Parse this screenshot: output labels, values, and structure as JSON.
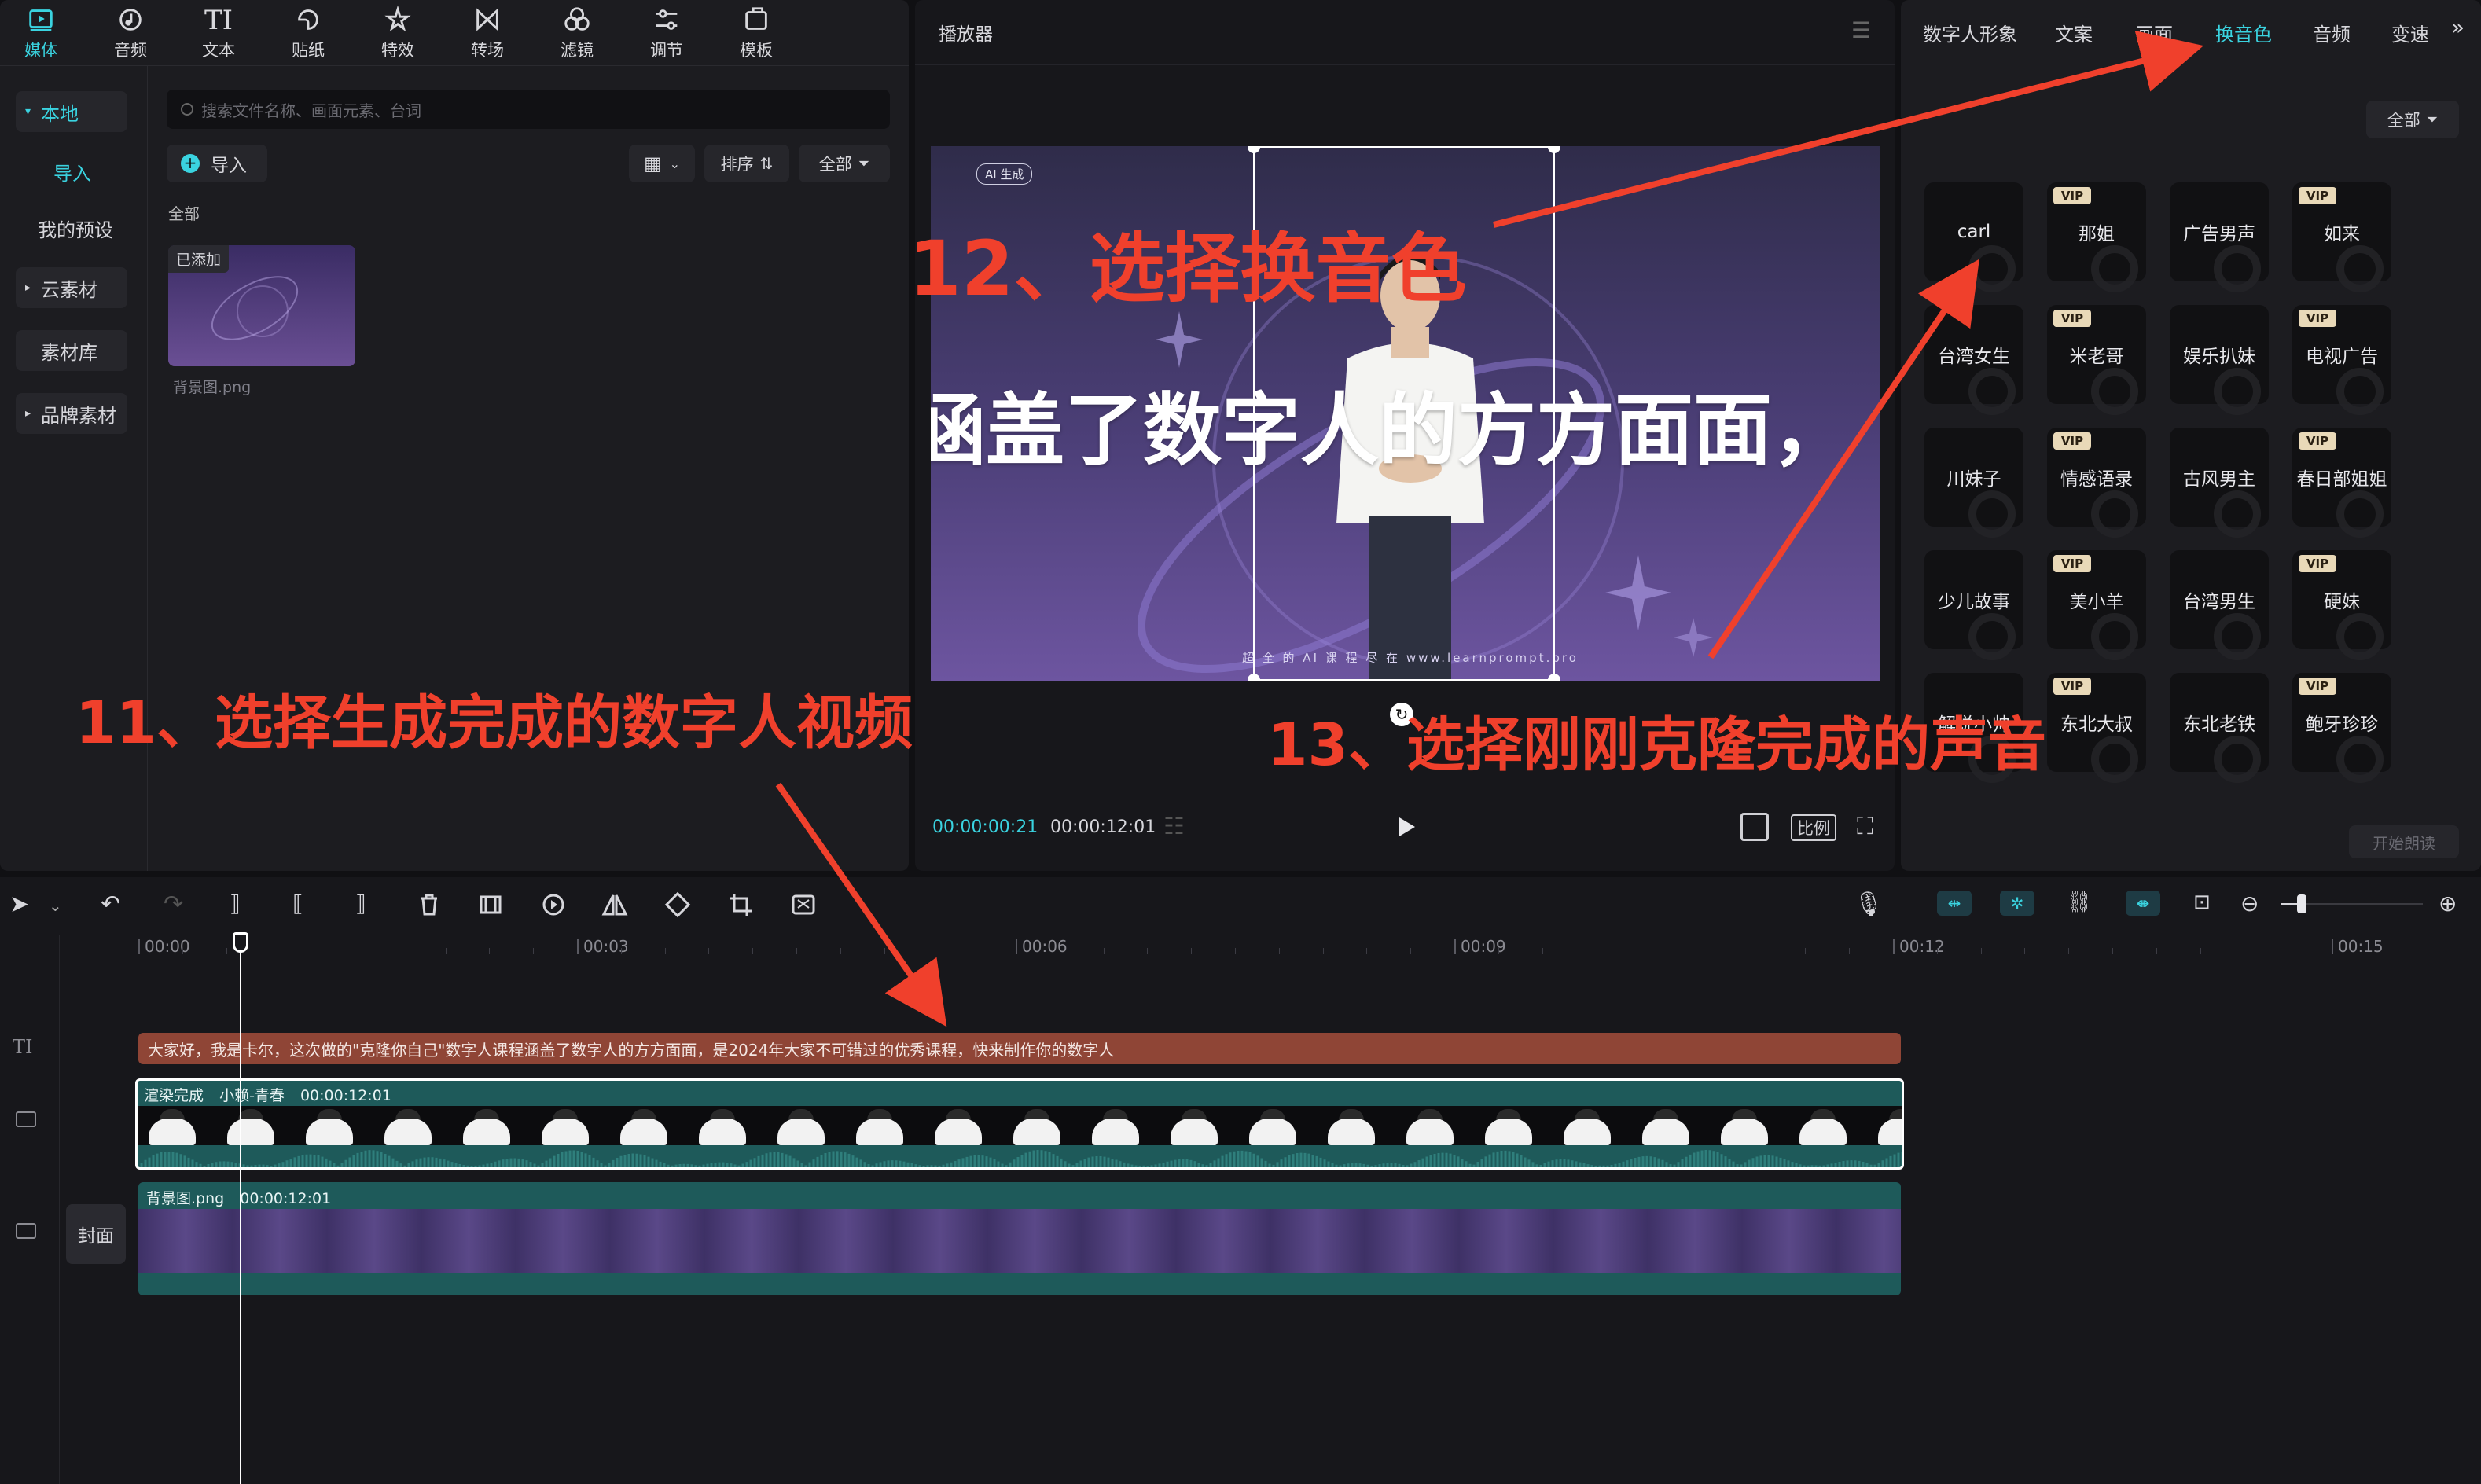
{
  "toolbar": {
    "items": [
      {
        "label": "媒体",
        "icon": "media-icon"
      },
      {
        "label": "音频",
        "icon": "audio-icon"
      },
      {
        "label": "文本",
        "icon": "text-icon"
      },
      {
        "label": "贴纸",
        "icon": "sticker-icon"
      },
      {
        "label": "特效",
        "icon": "effects-icon"
      },
      {
        "label": "转场",
        "icon": "transition-icon"
      },
      {
        "label": "滤镜",
        "icon": "filter-icon"
      },
      {
        "label": "调节",
        "icon": "adjust-icon"
      },
      {
        "label": "模板",
        "icon": "template-icon"
      }
    ],
    "text_icon_glyph": "TI"
  },
  "sidebar": {
    "items": [
      {
        "label": "本地"
      },
      {
        "label": "导入"
      },
      {
        "label": "我的预设"
      },
      {
        "label": "云素材"
      },
      {
        "label": "素材库"
      },
      {
        "label": "品牌素材"
      }
    ]
  },
  "media": {
    "search_placeholder": "搜索文件名称、画面元素、台词",
    "import_label": "导入",
    "sort_label": "排序",
    "filter_label": "全部",
    "section_label": "全部",
    "asset": {
      "badge": "已添加",
      "name": "背景图.png"
    }
  },
  "player": {
    "title": "播放器",
    "ai_badge": "AI 生成",
    "subtitle": "涵盖了数字人的方方面面，",
    "watermark": "超 全 的 AI 课 程 尽 在 www.learnprompt.pro",
    "time_current": "00:00:00:21",
    "time_total": "00:00:12:01",
    "ratio_label": "比例"
  },
  "right_panel": {
    "tabs": [
      "数字人形象",
      "文案",
      "画面",
      "换音色",
      "音频",
      "变速"
    ],
    "active_tab": "换音色",
    "filter_label": "全部",
    "vip_label": "VIP",
    "voices": [
      {
        "name": "carl",
        "vip": false
      },
      {
        "name": "那姐",
        "vip": true
      },
      {
        "name": "广告男声",
        "vip": false
      },
      {
        "name": "如来",
        "vip": true
      },
      {
        "name": "台湾女生",
        "vip": false
      },
      {
        "name": "米老哥",
        "vip": true
      },
      {
        "name": "娱乐扒妹",
        "vip": false
      },
      {
        "name": "电视广告",
        "vip": true
      },
      {
        "name": "川妹子",
        "vip": false
      },
      {
        "name": "情感语录",
        "vip": true
      },
      {
        "name": "古风男主",
        "vip": false
      },
      {
        "name": "春日部姐姐",
        "vip": true
      },
      {
        "name": "少儿故事",
        "vip": false
      },
      {
        "name": "美小羊",
        "vip": true
      },
      {
        "name": "台湾男生",
        "vip": false
      },
      {
        "name": "硬妹",
        "vip": true
      },
      {
        "name": "解说小帅",
        "vip": false
      },
      {
        "name": "东北大叔",
        "vip": true
      },
      {
        "name": "东北老铁",
        "vip": false
      },
      {
        "name": "鲍牙珍珍",
        "vip": true
      }
    ],
    "start_button": "开始朗读"
  },
  "timeline": {
    "ruler": [
      "00:00",
      "00:03",
      "00:06",
      "00:09",
      "00:12",
      "00:15"
    ],
    "text_track_glyph": "TI",
    "text_clip": "大家好，我是卡尔，这次做的\"克隆你自己\"数字人课程涵盖了数字人的方方面面，是2024年大家不可错过的优秀课程，快来制作你的数字人",
    "video_clip": {
      "status": "渲染完成",
      "name": "小赖-青春",
      "duration": "00:00:12:01"
    },
    "bg_clip": {
      "name": "背景图.png",
      "duration": "00:00:12:01"
    },
    "cover_label": "封面",
    "playhead_seconds": 0.7,
    "total_seconds": 12.03,
    "zoom_level": 0.5
  },
  "annotations": {
    "step11": "11、选择生成完成的数字人视频",
    "step12": "12、选择换音色",
    "step13": "13、选择刚刚克隆完成的声音"
  },
  "colors": {
    "accent": "#3ad3e0",
    "annotation_red": "#f0402c",
    "text_clip": "#8f4536",
    "video_clip": "#1e5a5a",
    "vip_gold": "#e9d9b8"
  }
}
